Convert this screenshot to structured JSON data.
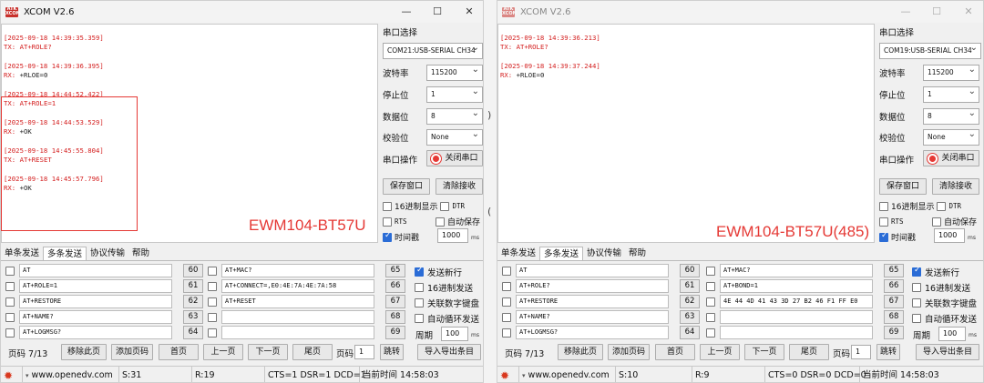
{
  "win1": {
    "title": "XCOM V2.6",
    "controls": {
      "min": "—",
      "max": "☐",
      "close": "✕"
    },
    "log": [
      {
        "ts": "[2025-09-18 14:39:35.359]",
        "dir": "TX:",
        "msg": "AT+ROLE?"
      },
      {
        "ts": "[2025-09-18 14:39:36.395]",
        "dir": "RX:",
        "msg": "+RLOE=0"
      },
      {
        "ts": "[2025-09-18 14:44:52.422]",
        "dir": "TX:",
        "msg": "AT+ROLE=1"
      },
      {
        "ts": "[2025-09-18 14:44:53.529]",
        "dir": "RX:",
        "msg": "+OK"
      },
      {
        "ts": "[2025-09-18 14:45:55.804]",
        "dir": "TX:",
        "msg": "AT+RESET"
      },
      {
        "ts": "[2025-09-18 14:45:57.796]",
        "dir": "RX:",
        "msg": "+OK"
      }
    ],
    "watermark": "EWM104-BT57U",
    "panel": {
      "port_title": "串口选择",
      "port": "COM21:USB-SERIAL CH34",
      "baud_label": "波特率",
      "baud": "115200",
      "stop_label": "停止位",
      "stop": "1",
      "data_label": "数据位",
      "data": "8",
      "parity_label": "校验位",
      "parity": "None",
      "op_label": "串口操作",
      "op_button": "关闭串口",
      "save_button": "保存窗口",
      "clear_button": "清除接收",
      "hex_display": "16进制显示",
      "dtr": "DTR",
      "rts": "RTS",
      "auto_save": "自动保存",
      "timestamp": "时间戳",
      "ts_value": "1000",
      "ts_unit": "ms"
    },
    "tabs": [
      "单条发送",
      "多条发送",
      "协议传输",
      "帮助"
    ],
    "multi": [
      {
        "text": "AT",
        "num": "60"
      },
      {
        "text": "AT+ROLE=1",
        "num": "61"
      },
      {
        "text": "AT+RESTORE",
        "num": "62"
      },
      {
        "text": "AT+NAME?",
        "num": "63"
      },
      {
        "text": "AT+LOGMSG?",
        "num": "64"
      },
      {
        "text": "AT+MAC?",
        "num": "65"
      },
      {
        "text": "AT+CONNECT=,E0:4E:7A:4E:7A:58",
        "num": "66"
      },
      {
        "text": "AT+RESET",
        "num": "67"
      },
      {
        "text": "",
        "num": "68"
      },
      {
        "text": "",
        "num": "69"
      }
    ],
    "right_opts": {
      "send_newline": "发送新行",
      "hex_send": "16进制发送",
      "link_keypad": "关联数字键盘",
      "auto_loop": "自动循环发送",
      "period_label": "周期",
      "period": "100",
      "period_unit": "ms"
    },
    "pagebar": {
      "page_label": "页码 7/13",
      "remove": "移除此页",
      "add": "添加页码",
      "first": "首页",
      "prev": "上一页",
      "next": "下一页",
      "last": "尾页",
      "page_jump_label": "页码",
      "page_jump_value": "1",
      "jump": "跳转",
      "import_export": "导入导出条目"
    },
    "status": {
      "url": "www.openedv.com",
      "s": "S:31",
      "r": "R:19",
      "lines": "CTS=1 DSR=1 DCD=1",
      "time": "当前时间 14:58:03"
    }
  },
  "win2": {
    "title": "XCOM V2.6",
    "controls": {
      "min": "—",
      "max": "☐",
      "close": "✕"
    },
    "log": [
      {
        "ts": "[2025-09-18 14:39:36.213]",
        "dir": "TX:",
        "msg": "AT+ROLE?"
      },
      {
        "ts": "[2025-09-18 14:39:37.244]",
        "dir": "RX:",
        "msg": "+RLOE=0"
      }
    ],
    "watermark": "EWM104-BT57U(485)",
    "panel": {
      "port_title": "串口选择",
      "port": "COM19:USB-SERIAL CH34",
      "baud_label": "波特率",
      "baud": "115200",
      "stop_label": "停止位",
      "stop": "1",
      "data_label": "数据位",
      "data": "8",
      "parity_label": "校验位",
      "parity": "None",
      "op_label": "串口操作",
      "op_button": "关闭串口",
      "save_button": "保存窗口",
      "clear_button": "清除接收",
      "hex_display": "16进制显示",
      "dtr": "DTR",
      "rts": "RTS",
      "auto_save": "自动保存",
      "timestamp": "时间戳",
      "ts_value": "1000",
      "ts_unit": "ms"
    },
    "tabs": [
      "单条发送",
      "多条发送",
      "协议传输",
      "帮助"
    ],
    "multi": [
      {
        "text": "AT",
        "num": "60"
      },
      {
        "text": "AT+ROLE?",
        "num": "61"
      },
      {
        "text": "AT+RESTORE",
        "num": "62"
      },
      {
        "text": "AT+NAME?",
        "num": "63"
      },
      {
        "text": "AT+LOGMSG?",
        "num": "64"
      },
      {
        "text": "AT+MAC?",
        "num": "65"
      },
      {
        "text": "AT+BOND=1",
        "num": "66"
      },
      {
        "text": "4E 44 4D 41 43 3D 27 B2 46 F1 FF E0",
        "num": "67"
      },
      {
        "text": "",
        "num": "68"
      },
      {
        "text": "",
        "num": "69"
      }
    ],
    "right_opts": {
      "send_newline": "发送新行",
      "hex_send": "16进制发送",
      "link_keypad": "关联数字键盘",
      "auto_loop": "自动循环发送",
      "period_label": "周期",
      "period": "100",
      "period_unit": "ms"
    },
    "pagebar": {
      "page_label": "页码 7/13",
      "remove": "移除此页",
      "add": "添加页码",
      "first": "首页",
      "prev": "上一页",
      "next": "下一页",
      "last": "尾页",
      "page_jump_label": "页码",
      "page_jump_value": "1",
      "jump": "跳转",
      "import_export": "导入导出条目"
    },
    "status": {
      "url": "www.openedv.com",
      "s": "S:10",
      "r": "R:9",
      "lines": "CTS=0 DSR=0 DCD=0",
      "time": "当前时间 14:58:03"
    }
  }
}
